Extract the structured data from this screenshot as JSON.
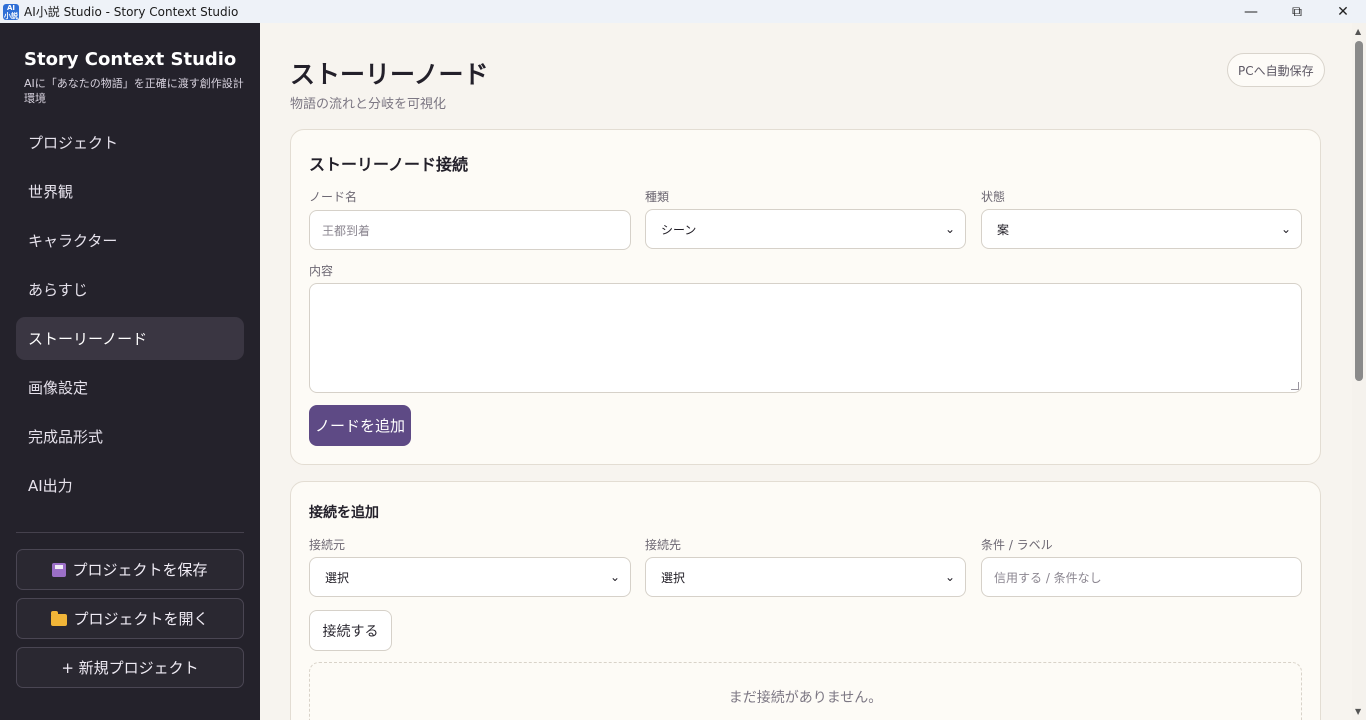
{
  "window": {
    "title": "AI小説 Studio - Story Context Studio",
    "app_icon_text": "AI\n小説",
    "minimize": "—",
    "maximize": "⧉",
    "close": "✕"
  },
  "sidebar": {
    "brand_title": "Story Context Studio",
    "brand_subtitle": "AIに「あなたの物語」を正確に渡す創作設計環境",
    "items": [
      {
        "label": "プロジェクト",
        "active": false
      },
      {
        "label": "世界観",
        "active": false
      },
      {
        "label": "キャラクター",
        "active": false
      },
      {
        "label": "あらすじ",
        "active": false
      },
      {
        "label": "ストーリーノード",
        "active": true
      },
      {
        "label": "画像設定",
        "active": false
      },
      {
        "label": "完成品形式",
        "active": false
      },
      {
        "label": "AI出力",
        "active": false
      }
    ],
    "save_label": "プロジェクトを保存",
    "open_label": "プロジェクトを開く",
    "new_label": "+ 新規プロジェクト"
  },
  "main": {
    "title": "ストーリーノード",
    "subtitle": "物語の流れと分岐を可視化",
    "autosave_label": "PCへ自動保存",
    "node_card": {
      "title": "ストーリーノード接続",
      "name_label": "ノード名",
      "name_placeholder": "王都到着",
      "type_label": "種類",
      "type_value": "シーン",
      "status_label": "状態",
      "status_value": "案",
      "content_label": "内容",
      "add_button": "ノードを追加"
    },
    "connection_card": {
      "title": "接続を追加",
      "from_label": "接続元",
      "from_value": "選択",
      "to_label": "接続先",
      "to_value": "選択",
      "condition_label": "条件 / ラベル",
      "condition_placeholder": "信用する / 条件なし",
      "connect_button": "接続する",
      "empty_text": "まだ接続がありません。"
    }
  }
}
